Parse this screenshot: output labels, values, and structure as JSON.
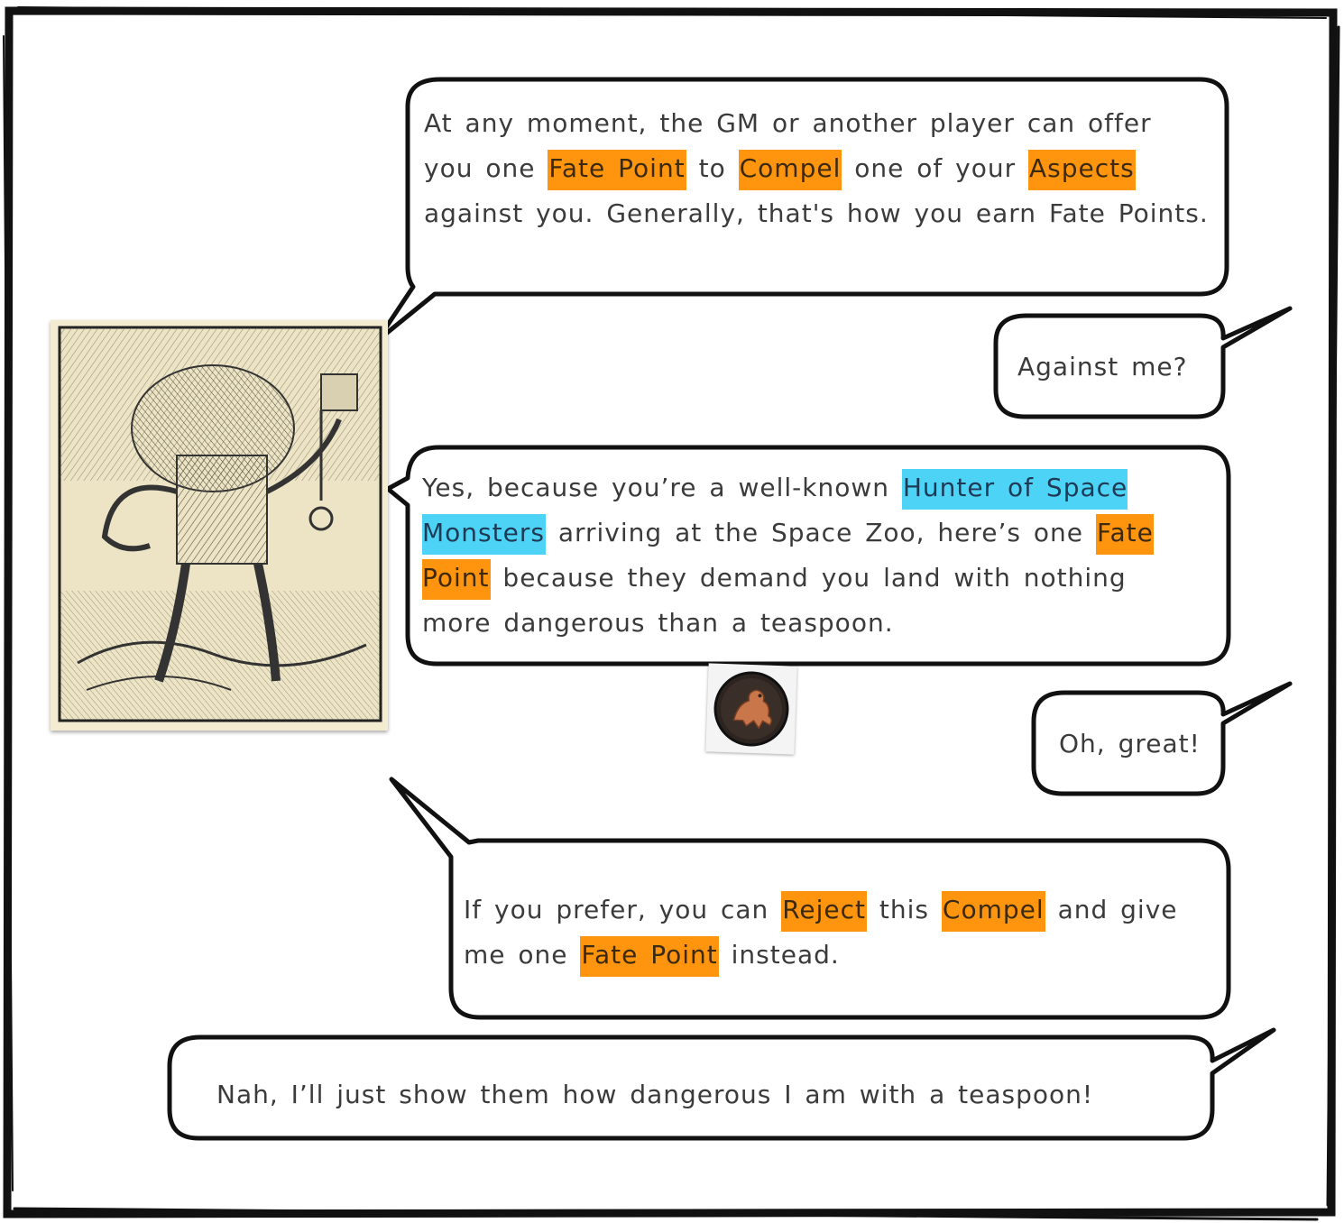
{
  "panel": {
    "bubbles": [
      {
        "speaker": "gm",
        "segments": [
          {
            "text": "At any moment, the GM or another player can offer you one ",
            "hl": ""
          },
          {
            "text": "Fate Point",
            "hl": "orange"
          },
          {
            "text": " to ",
            "hl": ""
          },
          {
            "text": "Compel",
            "hl": "orange"
          },
          {
            "text": " one of your ",
            "hl": ""
          },
          {
            "text": "Aspects",
            "hl": "orange"
          },
          {
            "text": " against you. Generally, that's how you earn Fate Points.",
            "hl": ""
          }
        ]
      },
      {
        "speaker": "player",
        "segments": [
          {
            "text": "Against me?",
            "hl": ""
          }
        ]
      },
      {
        "speaker": "gm",
        "segments": [
          {
            "text": "Yes, because you’re a well-known ",
            "hl": ""
          },
          {
            "text": "Hunter of Space Monsters",
            "hl": "blue"
          },
          {
            "text": " arriving at the Space Zoo, here’s one ",
            "hl": ""
          },
          {
            "text": "Fate Point",
            "hl": "orange"
          },
          {
            "text": " because they demand you land with nothing more dangerous than a teaspoon.",
            "hl": ""
          }
        ]
      },
      {
        "speaker": "player",
        "segments": [
          {
            "text": "Oh, great!",
            "hl": ""
          }
        ]
      },
      {
        "speaker": "gm",
        "segments": [
          {
            "text": "If you prefer, you can ",
            "hl": ""
          },
          {
            "text": "Reject",
            "hl": "orange"
          },
          {
            "text": " this ",
            "hl": ""
          },
          {
            "text": "Compel",
            "hl": "orange"
          },
          {
            "text": " and give me one ",
            "hl": ""
          },
          {
            "text": "Fate Point",
            "hl": "orange"
          },
          {
            "text": " instead.",
            "hl": ""
          }
        ]
      },
      {
        "speaker": "player",
        "segments": [
          {
            "text": "Nah, I’ll just show them how dangerous I am with a teaspoon!",
            "hl": ""
          }
        ]
      }
    ]
  },
  "images": {
    "gm_card": "woodcut-creature-illustration",
    "token": "lion-coin-token"
  },
  "colors": {
    "highlight_orange": "#ff950f",
    "highlight_blue": "#4dd3f5",
    "ink": "#1a1a1a",
    "card_paper": "#f3ecd0"
  }
}
